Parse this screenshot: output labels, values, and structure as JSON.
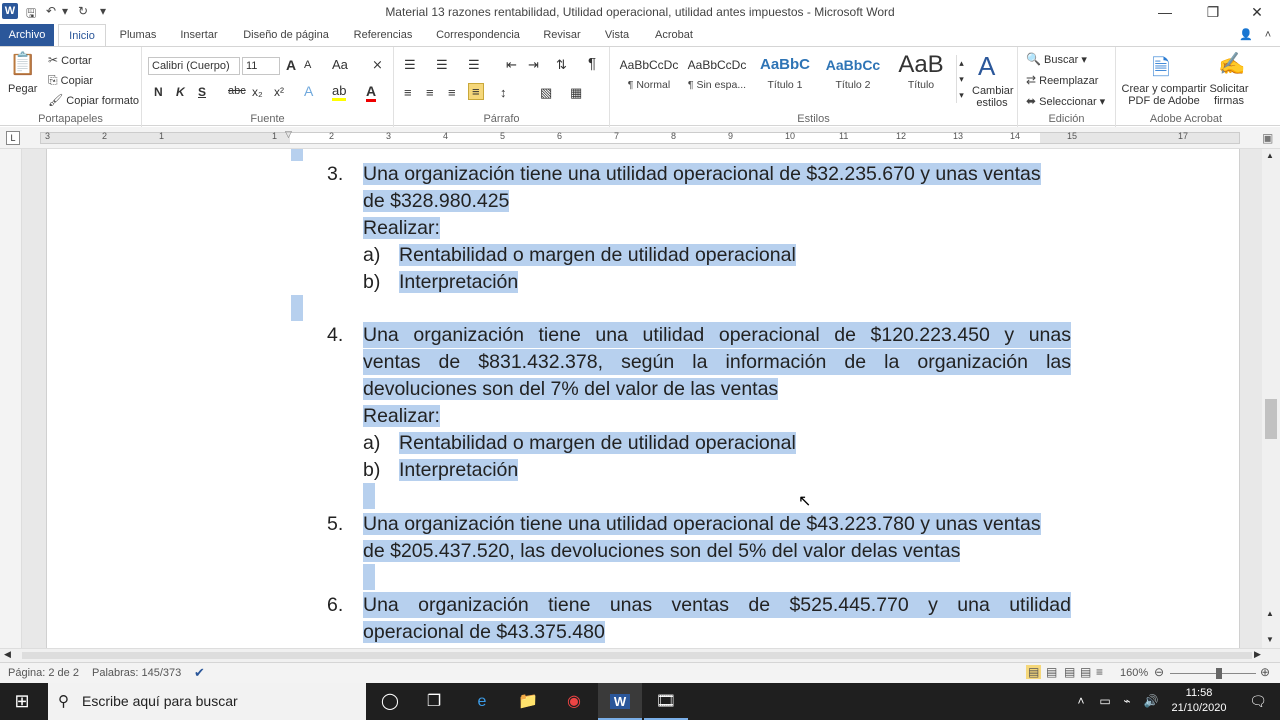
{
  "window": {
    "title": "Material 13 razones rentabilidad, Utilidad operacional, utilidad antes impuestos  -  Microsoft Word",
    "logo": "W"
  },
  "tabs": [
    "Archivo",
    "Inicio",
    "Plumas",
    "Insertar",
    "Diseño de página",
    "Referencias",
    "Correspondencia",
    "Revisar",
    "Vista",
    "Acrobat"
  ],
  "ribbon": {
    "clipboard": {
      "paste": "Pegar",
      "cut": "Cortar",
      "copy": "Copiar",
      "format": "Copiar formato",
      "label": "Portapapeles"
    },
    "font": {
      "name": "Calibri (Cuerpo)",
      "size": "11",
      "label": "Fuente",
      "size_up": "A",
      "size_down": "A",
      "case": "Aa",
      "bold": "N",
      "italic": "K",
      "underline": "S",
      "strike": "abc",
      "sub": "x₂",
      "sup": "x²"
    },
    "paragraph": {
      "label": "Párrafo",
      "pilcrow": "¶"
    },
    "styles": {
      "label": "Estilos",
      "items": [
        {
          "preview": "AaBbCcDc",
          "name": "¶ Normal"
        },
        {
          "preview": "AaBbCcDc",
          "name": "¶ Sin espa..."
        },
        {
          "preview": "AaBbC​",
          "name": "Título 1"
        },
        {
          "preview": "AaBbCc",
          "name": "Título 2"
        },
        {
          "preview": "AaB",
          "name": "Título"
        }
      ],
      "change": "Cambiar estilos",
      "change_a": "A"
    },
    "editing": {
      "label": "Edición",
      "find": "Buscar",
      "replace": "Reemplazar",
      "select": "Seleccionar"
    },
    "acrobat": {
      "label": "Adobe Acrobat",
      "create": "Crear y compartir PDF de Adobe",
      "sign": "Solicitar firmas"
    }
  },
  "ruler": {
    "numbers": [
      "3",
      "2",
      "1",
      "1",
      "2",
      "3",
      "4",
      "5",
      "6",
      "7",
      "8",
      "9",
      "10",
      "11",
      "12",
      "13",
      "14",
      "15",
      "17"
    ]
  },
  "document": {
    "items": [
      {
        "num": "3.",
        "lines": [
          "Una organización tiene una utilidad operacional de $32.235.670 y unas ventas",
          "de $328.980.425",
          "Realizar:"
        ],
        "subs": [
          {
            "l": "a)",
            "t": "Rentabilidad o margen de utilidad operacional"
          },
          {
            "l": "b)",
            "t": "Interpretación"
          }
        ]
      },
      {
        "num": "4.",
        "lines": [
          "Una organización tiene una utilidad operacional de $120.223.450 y unas",
          "ventas de $831.432.378, según la información de la organización las",
          "devoluciones son del 7% del valor de las ventas",
          "Realizar:"
        ],
        "subs": [
          {
            "l": "a)",
            "t": "Rentabilidad o margen de utilidad operacional"
          },
          {
            "l": "b)",
            "t": "Interpretación"
          }
        ]
      },
      {
        "num": "5.",
        "lines": [
          "Una organización tiene una utilidad operacional de $43.223.780 y unas ventas",
          "de $205.437.520, las devoluciones son del 5% del valor delas ventas"
        ]
      },
      {
        "num": "6.",
        "lines": [
          "Una organización tiene unas ventas de $525.445.770 y una utilidad",
          "operacional de $43.375.480"
        ]
      }
    ]
  },
  "status": {
    "page": "Página: 2 de 2",
    "words": "Palabras: 145/373",
    "zoom": "160%"
  },
  "taskbar": {
    "search": "Escribe aquí para buscar",
    "time": "11:58",
    "date": "21/10/2020"
  }
}
